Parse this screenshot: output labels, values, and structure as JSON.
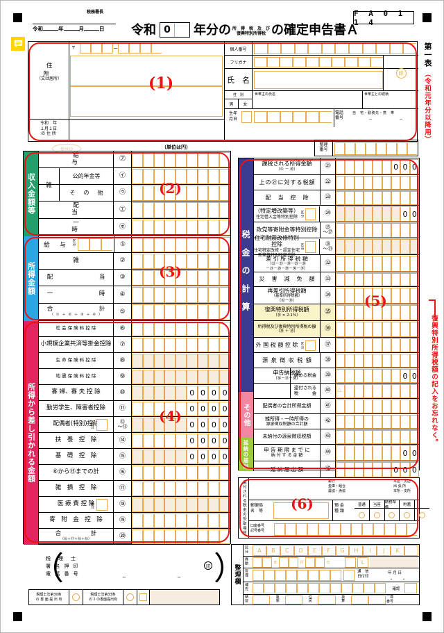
{
  "meta": {
    "form_code": "F A 0 1 1 4",
    "sheet_label": "第一表",
    "sheet_sub": "（令和元年分以降用）",
    "unit_note": "（単位は円）",
    "side_warning": "復興特別所得税額の記入をお忘れなく。"
  },
  "header": {
    "tax_office_label": "税務署長",
    "date_prefix": "令和",
    "date_year": "年",
    "date_month": "月",
    "date_day": "日",
    "title_reiwa": "令和",
    "title_year_suffix": "年分の",
    "title_ruby_top": "所　得　税　及　び",
    "title_ruby_bottom": "復興特別所得税",
    "title_tail": "の確定申告書Ａ",
    "year_box_value": "0",
    "receipt_stamp": "受付印"
  },
  "identity": {
    "postal_mark": "〒",
    "address_label": "住　所",
    "address_sub": "（又は居所）",
    "jan1_label_1": "令和　年",
    "jan1_label_2": "１月１日",
    "jan1_label_3": "の 住 所",
    "my_number_label": "個人番号",
    "furigana_label": "フリガナ",
    "name_label": "氏　名",
    "seal_mark": "印",
    "gender_label": "性　別",
    "gender_male": "男",
    "gender_female": "女",
    "householder_name_label": "世帯主の氏名",
    "householder_relation_label": "世帯主との続柄",
    "birth_label_1": "生年",
    "birth_label_2": "月日",
    "phone_label_1": "電話",
    "phone_label_2": "番号",
    "phone_types": "自　宅・勤務先・携　帯",
    "phone_dash": "−",
    "seiri_label_1": "整理",
    "seiri_label_2": "番号"
  },
  "income_receipts": {
    "band": "収入金額等",
    "rows": [
      {
        "label": "給　　　　　　　与",
        "mark": "㋐"
      },
      {
        "label": "公的年金等",
        "mark": "㋑",
        "group": "雑"
      },
      {
        "label": "そ　の　他",
        "mark": "㋒",
        "group": "雑"
      },
      {
        "label": "配　　　　　　　当",
        "mark": "㋓"
      },
      {
        "label": "一　　　　　　　時",
        "mark": "㋔"
      }
    ],
    "group_label": "雑"
  },
  "income_amounts": {
    "band": "所得金額",
    "rows": [
      {
        "label": "給　与",
        "mark": "①",
        "has_kubun": true,
        "kubun_label": "区分"
      },
      {
        "label": "雑",
        "mark": "②"
      },
      {
        "label": "配　　　　　当",
        "mark": "③"
      },
      {
        "label": "一　　　　　時",
        "mark": "④"
      },
      {
        "label": "合　　　　　計",
        "sub": "（①＋②＋③＋④）",
        "mark": "⑤"
      }
    ]
  },
  "deductions": {
    "band": "所得から差し引かれる金額",
    "rows": [
      {
        "label": "社 会 保 険 料 控 除",
        "mark": "⑥",
        "zeros": 0
      },
      {
        "label": "小規模企業共済等掛金控除",
        "mark": "⑦",
        "zeros": 0
      },
      {
        "label": "生 命 保 険 料 控 除",
        "mark": "⑧",
        "zeros": 0,
        "shaded": true
      },
      {
        "label": "地 震 保 険 料 控 除",
        "mark": "⑨",
        "zeros": 0,
        "shaded": true
      },
      {
        "label": "寡 婦、寡 夫 控 除",
        "mark": "⑩",
        "zeros": 4,
        "shaded": true
      },
      {
        "label": "勤労学生、障害者控除",
        "mark": "⑪",
        "zeros": 4
      },
      {
        "label": "配偶者(特別)控除",
        "mark": "⑫\n～⑬",
        "zeros": 4,
        "has_kubun": true,
        "kubun_label": "区分",
        "shaded": true
      },
      {
        "label": "扶　養　控　除",
        "mark": "⑭",
        "zeros": 4
      },
      {
        "label": "基　礎　控　除",
        "mark": "⑮",
        "zeros": 4,
        "shaded": true
      },
      {
        "label": "⑥から⑮までの計",
        "mark": "⑯",
        "zeros": 0
      },
      {
        "label": "雑　損　控　除",
        "mark": "⑰",
        "zeros": 0
      },
      {
        "label": "医 療 費 控 除",
        "mark": "⑱",
        "zeros": 0,
        "has_kubun": true,
        "kubun_label": "区分",
        "shaded": true
      },
      {
        "label": "寄　附　金　控　除",
        "mark": "⑲",
        "zeros": 0
      },
      {
        "label": "合　　　　　計",
        "sub": "（⑯＋⑰＋⑱＋⑲）",
        "mark": "⑳",
        "zeros": 0
      }
    ]
  },
  "tax_calc": {
    "band": "税金の計算",
    "rows": [
      {
        "label": "課税される所得金額",
        "sub": "（⑤ － ⑳）",
        "mark": "㉑",
        "zeros": 3
      },
      {
        "label": "上の㉑に対する税額",
        "mark": "㉒",
        "zeros": 0
      },
      {
        "label": "配　当　控　除",
        "mark": "㉓",
        "zeros": 0
      },
      {
        "label": "（特定増改築等）",
        "label2": "住宅借入金等特別控除",
        "mark": "㉔",
        "zeros": 2,
        "has_kubun": true,
        "kubun_label": "区分",
        "shaded": true
      },
      {
        "label": "政党等寄附金等特別控除",
        "mark": "㉕\n～㉗",
        "zeros": 0
      },
      {
        "label": "住宅耐震改修特別控除",
        "label2": "住宅特定改修・認定住宅",
        "label3": "新築等特別税額控除",
        "mark": "㉘\n～㉛",
        "zeros": 0,
        "has_kubun": true,
        "kubun_label": "区分",
        "shaded": true
      },
      {
        "label": "差 引 所 得 税 額",
        "sub": "（㉒－㉓－㉔－㉕－㉖",
        "sub2": "－㉗－㉘－㉙－㉚－㉛）",
        "mark": "㉜",
        "zeros": 0
      },
      {
        "label": "災　害　減　免　額",
        "mark": "㉝",
        "zeros": 0
      },
      {
        "label": "再差引所得税額",
        "sub": "（基準所得税額）",
        "sub2": "（㉜－㉝）",
        "mark": "㉞",
        "zeros": 0
      },
      {
        "label": "復興特別所得税額",
        "sub": "（㉞ × 2.1％）",
        "mark": "㉟",
        "zeros": 0,
        "yellow": true
      },
      {
        "label": "所得税及び復興特別所得税の額",
        "sub": "（㉞ ＋ ㉟）",
        "mark": "㊱",
        "zeros": 0,
        "yellow": true
      },
      {
        "label": "外 国 税 額 控 除",
        "mark": "㊲",
        "zeros": 0,
        "has_kubun": true,
        "kubun_label": "区分"
      },
      {
        "label": "源 泉 徴 収 税 額",
        "mark": "㊳",
        "zeros": 0
      },
      {
        "label": "申告納税額",
        "sub": "（㊱－㊲－㊳）",
        "mark": "㊴",
        "right_label": "納める税金",
        "zeros": 2
      },
      {
        "label": "",
        "mark": "㊵",
        "right_label": "還付される",
        "right_label2": "税　　　金",
        "zeros": 0,
        "triangle": true
      }
    ]
  },
  "others": {
    "band": "その他",
    "rows": [
      {
        "label": "配偶者の合計所得金額",
        "mark": "㊶"
      },
      {
        "label": "雑所得・一時所得の",
        "label2": "源泉徴収税額の合計額",
        "mark": "㊷"
      },
      {
        "label": "未納付の源泉徴収税額",
        "mark": "㊸"
      }
    ]
  },
  "deferral": {
    "band": "延納の届出",
    "rows": [
      {
        "label": "申 告 期 限 ま で に",
        "label2": "納 付 す る 金 額",
        "mark": "㊹",
        "zeros": 2
      },
      {
        "label": "延 納 届 出 額",
        "mark": "㊺",
        "zeros": 3
      }
    ]
  },
  "refund_bank": {
    "band": "還付される税金の受取場所",
    "bank_type_1": "銀行",
    "bank_type_2": "金庫・組合",
    "bank_type_3": "農協・漁協",
    "branch_1": "本店・支店",
    "branch_2": "出 張 所",
    "branch_3": "本所・支所",
    "post_office_1": "郵便局",
    "post_office_2": "名　等",
    "deposit_1": "預 金",
    "deposit_2": "種 類",
    "deposit_types": [
      "普通",
      "当座",
      "納税準備",
      "貯蓄"
    ],
    "account_1": "口座番号",
    "account_2": "記号番号"
  },
  "tax_agent": {
    "line1": "税　理　士",
    "line2": "署 名 押 印",
    "line3": "電 話 番 号",
    "seal": "印",
    "dash": "−",
    "note30_1": "税理士法第30条",
    "note30_2": "の 書 面 提 出 有",
    "note33_1": "税理士法第33条",
    "note33_2": "の 2 の書面提出有"
  },
  "seiri_ran": {
    "band": "整理欄",
    "row_kubun": "区分",
    "kubun_letters": [
      "A",
      "B",
      "C",
      "D",
      "E",
      "F",
      "G",
      "H",
      "I",
      "J",
      "K"
    ],
    "row_idou": "異動",
    "idou_year": "年",
    "idou_month": "月",
    "idou_day": "日",
    "idou_l": "L",
    "row_kanri": "管理",
    "tsushin_1": "通　信",
    "tsushin_2": "日付印",
    "tsushin_ymd_1": "年",
    "tsushin_ymd_2": "月",
    "tsushin_ymd_3": "日",
    "tsushin_dots": "・　　・",
    "row_hoju": "補完",
    "kakunin": "確認",
    "row_nouzei": "納管",
    "meisai_1": "車　賑",
    "meisai_2": "住　民",
    "meisai_3": "検　算",
    "ichiren_1": "一連",
    "ichiren_2": "番号"
  },
  "colors": {
    "red_highlight": "#ee1111",
    "band_green": "#22a06b",
    "band_blue": "#28a7e3",
    "band_pink": "#e3245f",
    "band_navy": "#3b3b8f",
    "band_rose": "#f2889f",
    "band_lime": "#9ccb3b",
    "field_orange": "#e8ab4f",
    "yellow_icon": "#ffd400"
  },
  "annotations": {
    "n1": "(1)",
    "n2": "(2)",
    "n3": "(3)",
    "n4": "(4)",
    "n5": "(5)",
    "n6": "(6)"
  }
}
